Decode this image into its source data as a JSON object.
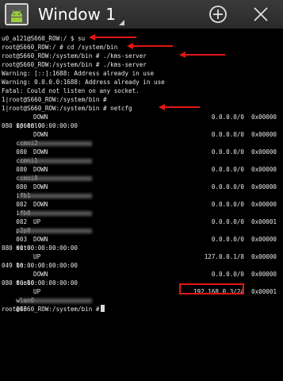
{
  "window": {
    "title": "Window 1"
  },
  "terminal": {
    "line0": "u0_a121@S660_ROW:/ $ su",
    "line1": "root@S660_ROW:/ # cd /system/bin",
    "line2": "root@S660_ROW:/system/bin # ./kms-server",
    "line3": "root@S660_ROW:/system/bin # ./kms-server",
    "line4": "Warning: [::]:1688: Address already in use",
    "line5": "Warning: 0.0.0.0:1688: Address already in use",
    "line6": "Fatal: Could not listen on any socket.",
    "line7": "1|root@S660_ROW:/system/bin #",
    "line8": "1|root@S660_ROW:/system/bin # netcfg",
    "iface_rows": [
      {
        "name": "ip6tnl0",
        "state": "DOWN",
        "ip": "0.0.0.0/0",
        "flags": "0x00000",
        "mac": "080 00:00:00:00:00:00"
      },
      {
        "name": "ccmni2",
        "state": "DOWN",
        "ip": "0.0.0.0/0",
        "flags": "0x00000",
        "mac": "080"
      },
      {
        "name": "ccmni1",
        "state": "DOWN",
        "ip": "0.0.0.0/0",
        "flags": "0x00000",
        "mac": "080"
      },
      {
        "name": "ccmni0",
        "state": "DOWN",
        "ip": "0.0.0.0/0",
        "flags": "0x00000",
        "mac": "080"
      },
      {
        "name": "ifb1",
        "state": "DOWN",
        "ip": "0.0.0.0/0",
        "flags": "0x00000",
        "mac": "082"
      },
      {
        "name": "ifb0",
        "state": "DOWN",
        "ip": "0.0.0.0/0",
        "flags": "0x00000",
        "mac": "082"
      },
      {
        "name": "p2p0",
        "state": "UP",
        "ip": "0.0.0.0/0",
        "flags": "0x00001",
        "mac": "003"
      },
      {
        "name": "sit0",
        "state": "DOWN",
        "ip": "0.0.0.0/0",
        "flags": "0x00000",
        "mac": "080 00:00:00:00:00:00"
      },
      {
        "name": "lo",
        "state": "UP",
        "ip": "127.0.0.1/8",
        "flags": "0x00000",
        "mac": "049 00:00:00:00:00:00"
      },
      {
        "name": "tunl0",
        "state": "DOWN",
        "ip": "0.0.0.0/0",
        "flags": "0x00000",
        "mac": "080 00:00:00:00:00:00"
      },
      {
        "name": "wlan0",
        "state": "UP",
        "ip": "192.168.0.3/24",
        "flags": "0x00001",
        "mac": "043"
      }
    ],
    "final_prompt": "root@S660_ROW:/system/bin #"
  }
}
